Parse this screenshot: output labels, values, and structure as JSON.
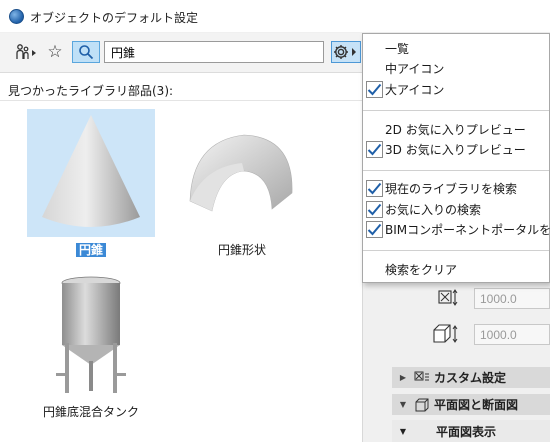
{
  "window": {
    "title": "オブジェクトのデフォルト設定"
  },
  "toolbar": {
    "search_value": "円錐",
    "people_icon": "library-people-icon",
    "star_icon": "star-icon",
    "search_icon": "search-icon",
    "gear_icon": "gear-icon"
  },
  "results": {
    "label": "見つかったライブラリ部品(3):",
    "items": [
      {
        "name": "円錐",
        "selected": true
      },
      {
        "name": "円錐形状",
        "selected": false
      },
      {
        "name": "円錐底混合タンク",
        "selected": false
      }
    ]
  },
  "menu": {
    "items": [
      {
        "label": "一覧",
        "checked": false
      },
      {
        "label": "中アイコン",
        "checked": false
      },
      {
        "label": "大アイコン",
        "checked": true
      },
      {
        "label": "2D お気に入りプレビュー",
        "checked": false
      },
      {
        "label": "3D お気に入りプレビュー",
        "checked": true
      },
      {
        "label": "現在のライブラリを検索",
        "checked": true
      },
      {
        "label": "お気に入りの検索",
        "checked": true
      },
      {
        "label": "BIMコンポーネントポータルを検索",
        "checked": true
      },
      {
        "label": "検索をクリア",
        "checked": false
      }
    ]
  },
  "settings": {
    "dim_a": "1000.0",
    "dim_b": "1000.0",
    "sections": [
      {
        "label": "カスタム設定",
        "expanded": false
      },
      {
        "label": "平面図と断面図",
        "expanded": true
      }
    ],
    "subsection": "平面図表示"
  },
  "colors": {
    "accent": "#3b89d6",
    "selection_bg": "#cde5f8",
    "check": "#1f5fa8"
  }
}
